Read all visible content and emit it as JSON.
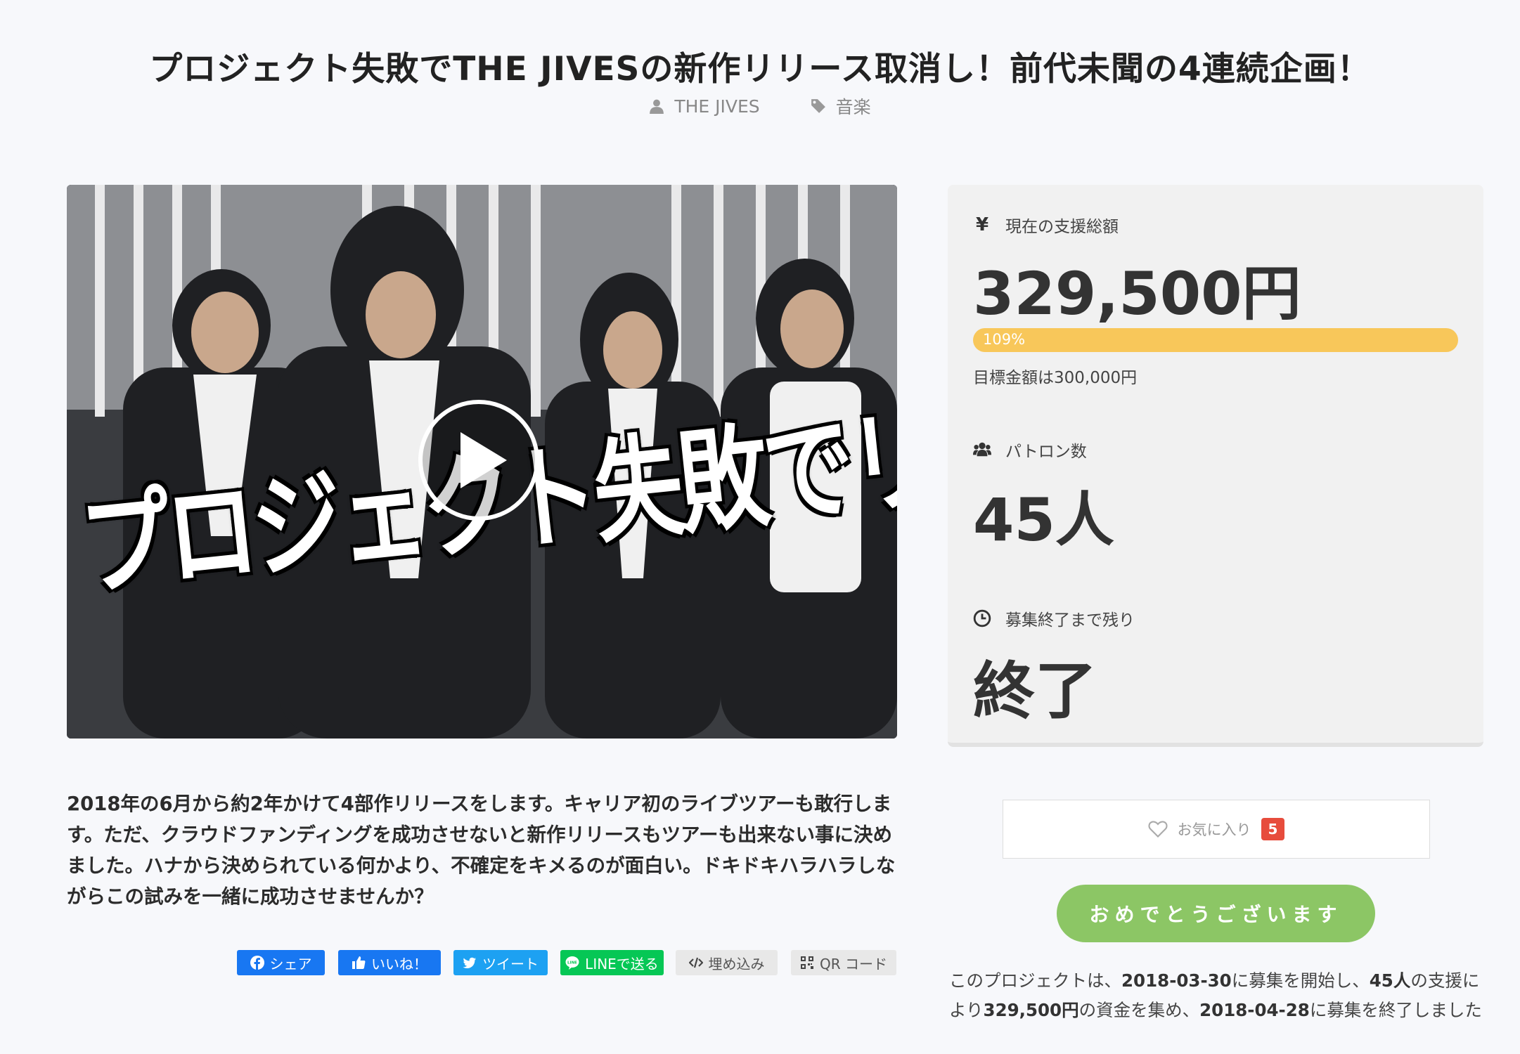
{
  "project": {
    "title": "プロジェクト失敗でTHE JIVESの新作リリース取消し！前代未聞の4連続企画！",
    "owner": "THE JIVES",
    "category": "音楽",
    "thumbnail_overlay_text": "プロジェクト失敗でリリース取消！",
    "description": "2018年の6月から約2年かけて4部作リリースをします。キャリア初のライブツアーも敢行します。ただ、クラウドファンディングを成功させないと新作リリースもツアーも出来ない事に決めました。ハナから決められている何かより、不確定をキメるのが面白い。ドキドキハラハラしながらこの試みを一緒に成功させませんか？"
  },
  "share": {
    "facebook": "シェア",
    "like": "いいね！",
    "tweet": "ツイート",
    "line": "LINEで送る",
    "embed": "埋め込み",
    "qr": "QR コード"
  },
  "stats": {
    "amount_label": "現在の支援総額",
    "amount": "329,500円",
    "progress_text": "109%",
    "progress_fraction": 1.09,
    "goal": "目標金額は300,000円",
    "patrons_label": "パトロン数",
    "patrons": "45人",
    "remaining_label": "募集終了まで残り",
    "remaining": "終了"
  },
  "actions": {
    "favorite_label": "お気に入り",
    "favorite_count": "5",
    "congrats": "おめでとうございます"
  },
  "summary": {
    "t1": "このプロジェクトは、",
    "start": "2018-03-30",
    "t2": "に募集を開始し、",
    "patrons": "45人",
    "t3": "の支援により",
    "amount": "329,500円",
    "t4": "の資金を集め、",
    "end": "2018-04-28",
    "t5": "に募集を終了しました"
  },
  "colors": {
    "progress": "#f8c75a",
    "congrats": "#8cc665",
    "facebook": "#1877f2",
    "twitter": "#1da1f2",
    "line": "#06c755",
    "badge": "#e74c3c"
  }
}
